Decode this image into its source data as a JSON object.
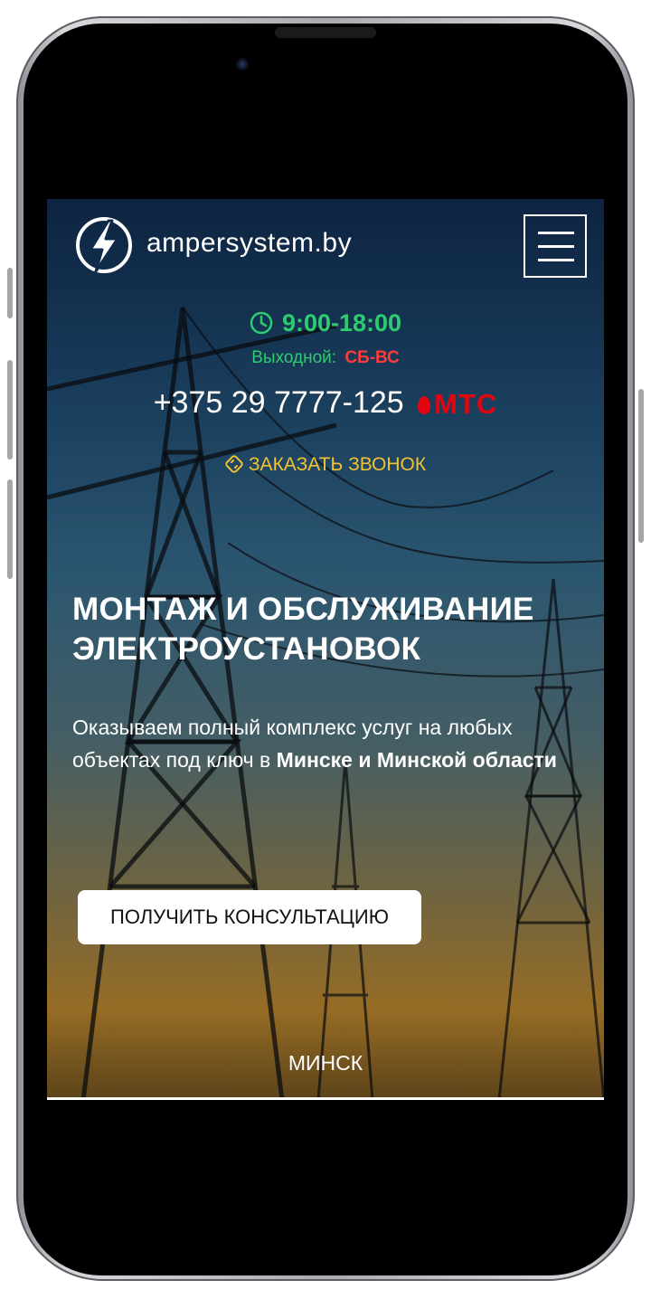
{
  "header": {
    "site_name": "ampersystem.by",
    "logo_icon": "lightning-bolt-icon",
    "menu_icon": "hamburger-menu-icon"
  },
  "schedule": {
    "hours": "9:00-18:00",
    "dayoff_label": "Выходной:",
    "dayoff_value": "СБ-ВС"
  },
  "contact": {
    "phone": "+375 29 7777-125",
    "operator": "МТС",
    "callback_label": "ЗАКАЗАТЬ ЗВОНОК"
  },
  "hero": {
    "title_line1": "МОНТАЖ И ОБСЛУЖИВАНИЕ",
    "title_line2": "ЭЛЕКТРОУСТАНОВОК",
    "subtitle_plain": "Оказываем полный комплекс услуг на любых объектах под ключ в ",
    "subtitle_bold": "Минске и Минской области",
    "cta_label": "ПОЛУЧИТЬ КОНСУЛЬТАЦИЮ"
  },
  "footer_tab": {
    "city": "МИНСК"
  },
  "colors": {
    "accent_green": "#2ecc71",
    "accent_red": "#ff3b3b",
    "mts_red": "#e30611",
    "callback_yellow": "#f2c230"
  }
}
